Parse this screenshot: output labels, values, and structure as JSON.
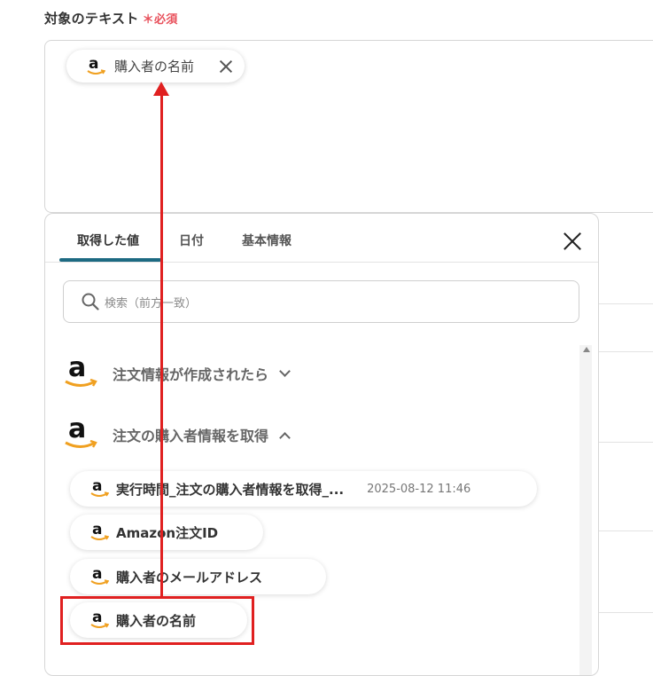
{
  "field": {
    "label": "対象のテキスト",
    "required_mark": "＊必須",
    "chip_label": "購入者の名前"
  },
  "panel": {
    "tabs": [
      {
        "label": "取得した値"
      },
      {
        "label": "日付"
      },
      {
        "label": "基本情報"
      }
    ],
    "search_placeholder": "検索（前方一致）",
    "groups": [
      {
        "title": "注文情報が作成されたら",
        "expanded": false,
        "icon": "amazon-icon"
      },
      {
        "title": "注文の購入者情報を取得",
        "expanded": true,
        "icon": "amazon-icon"
      }
    ],
    "items": [
      {
        "label": "実行時間_注文の購入者情報を取得_...",
        "value": "2025-08-12 11:46"
      },
      {
        "label": "Amazon注文ID",
        "value": ""
      },
      {
        "label": "購入者のメールアドレス",
        "value": ""
      },
      {
        "label": "購入者の名前",
        "value": ""
      }
    ]
  },
  "colors": {
    "accent_tab": "#1d6a82",
    "annotation": "#e02020",
    "required": "#e8505b"
  }
}
